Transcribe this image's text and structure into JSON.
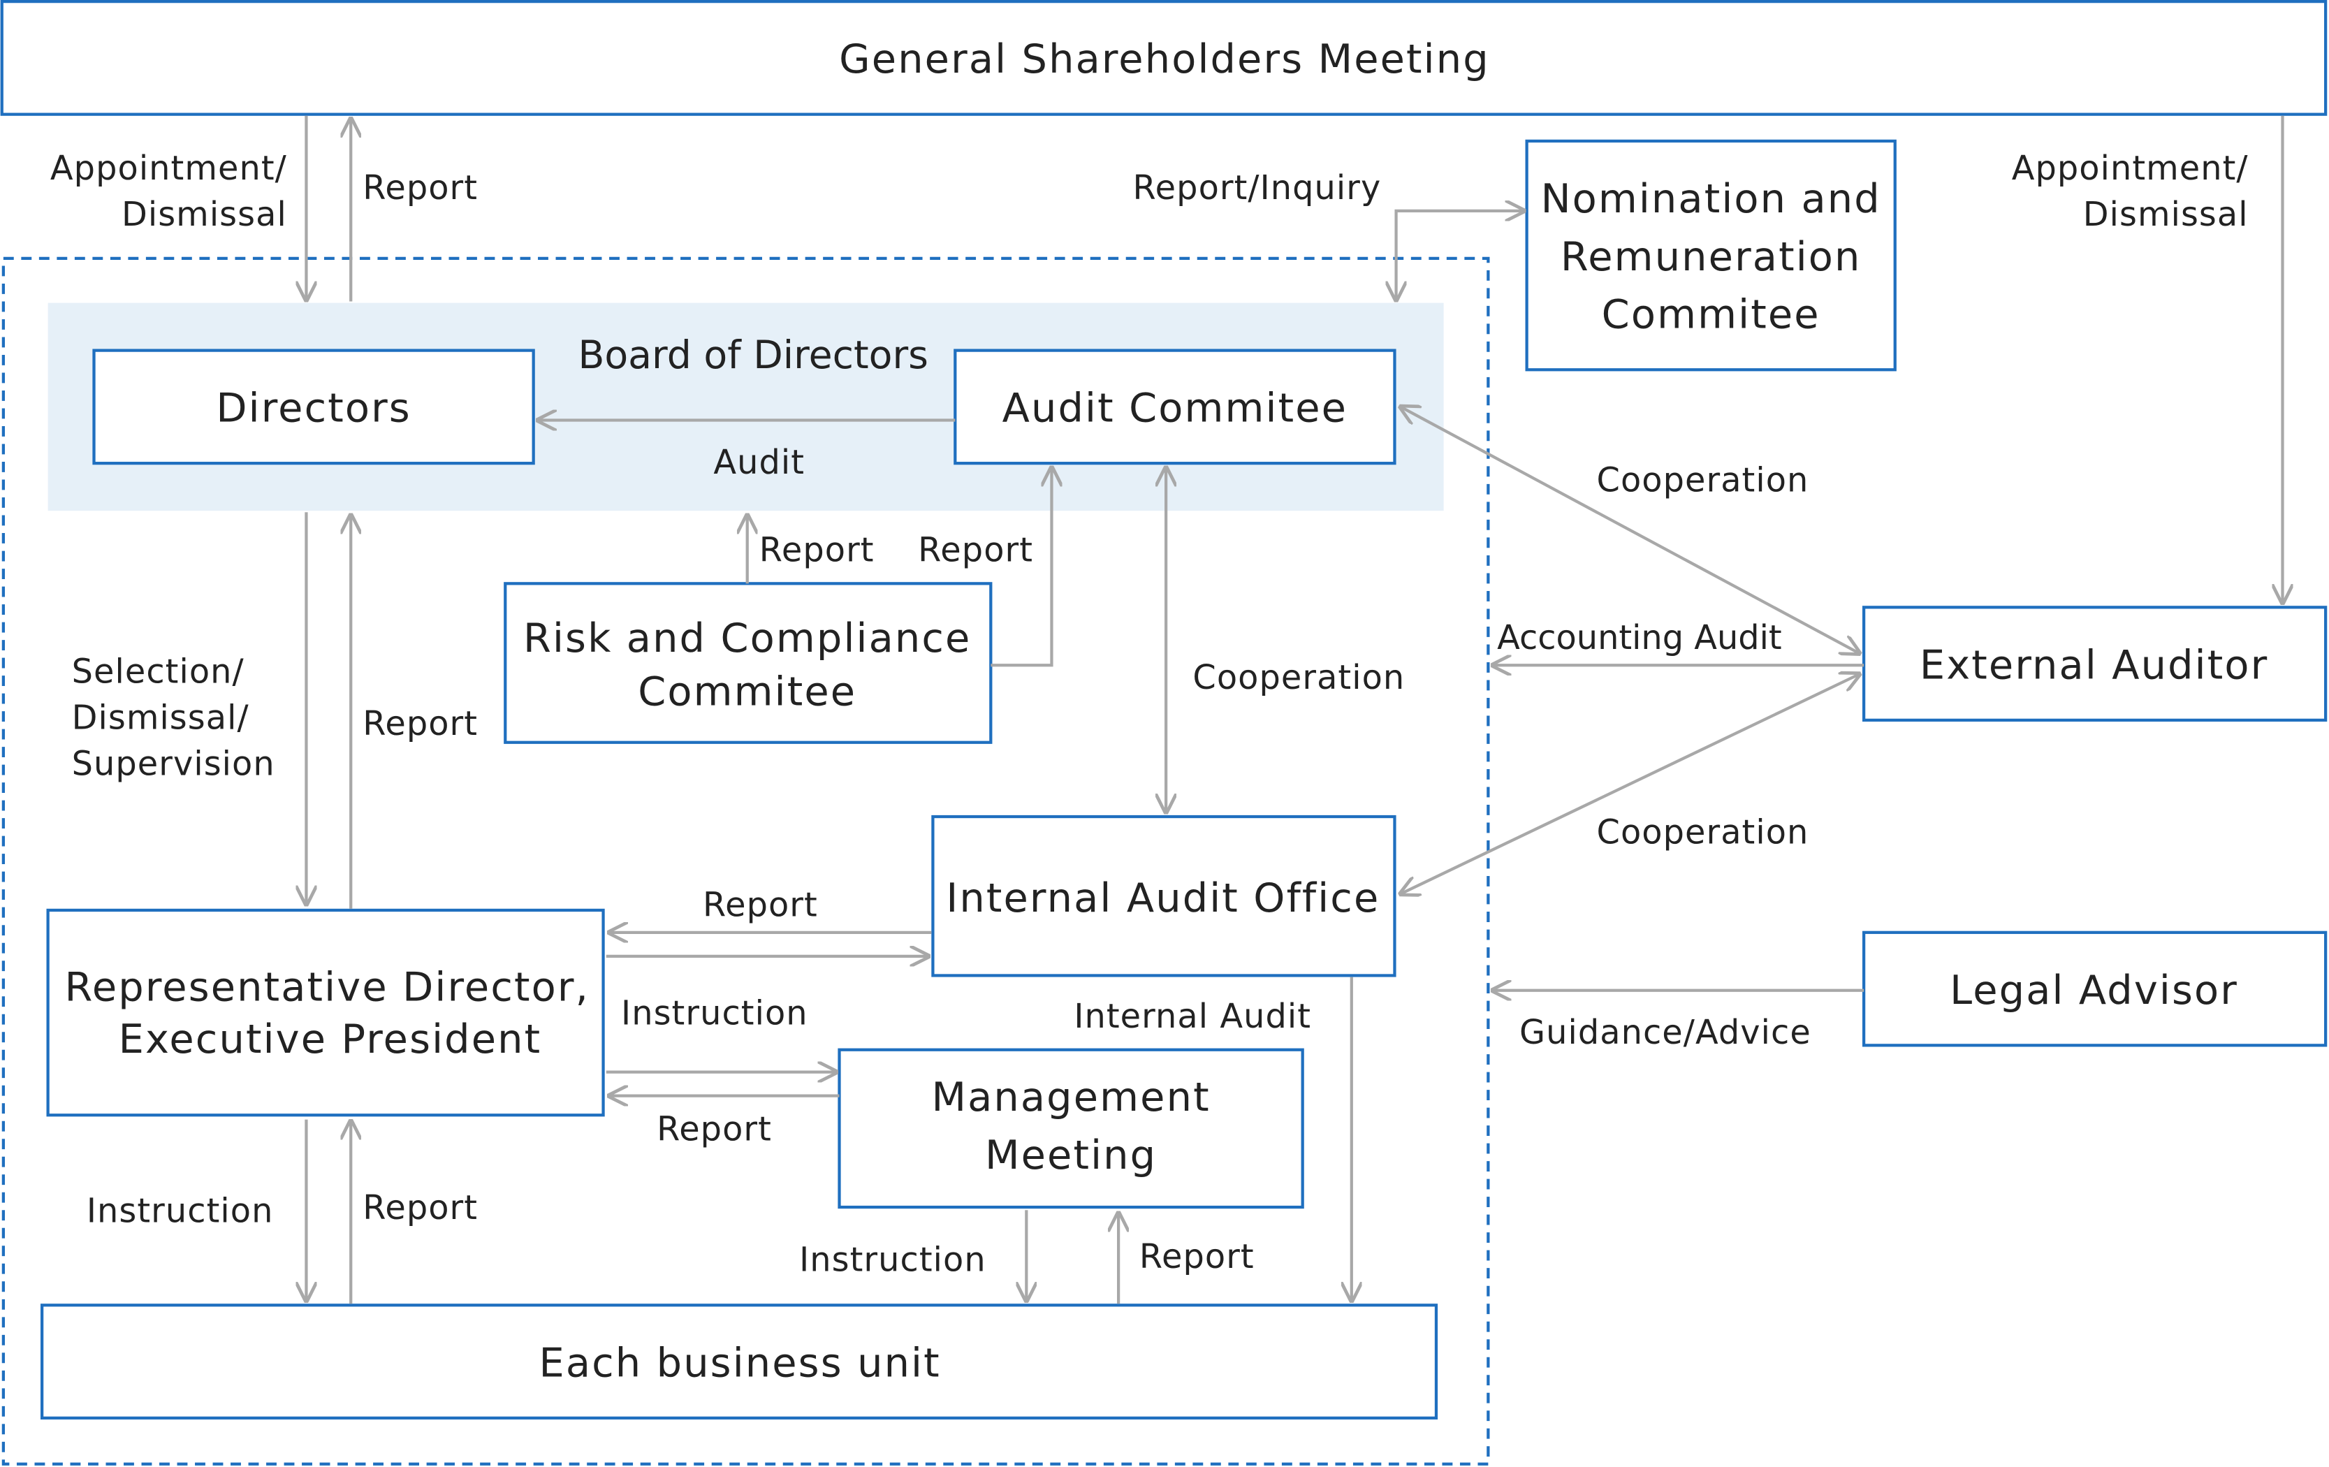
{
  "colors": {
    "border": "#1f6fbf",
    "board_bg": "#e6f0f8",
    "arrow": "#a8a8a8",
    "text": "#222222"
  },
  "boxes": {
    "gsm": "General Shareholders Meeting",
    "board": "Board of Directors",
    "directors": "Directors",
    "audit_committee": "Audit Commitee",
    "nomination": [
      "Nomination and",
      "Remuneration",
      "Commitee"
    ],
    "risk": [
      "Risk and Compliance",
      "Commitee"
    ],
    "internal_audit": "Internal Audit Office",
    "rep_director": [
      "Representative Director,",
      "Executive President"
    ],
    "management": [
      "Management",
      "Meeting"
    ],
    "business_unit": "Each business unit",
    "external_auditor": "External Auditor",
    "legal_advisor": "Legal Advisor"
  },
  "labels": {
    "appoint_left": [
      "Appointment/",
      "Dismissal"
    ],
    "report_gsm": "Report",
    "report_inquiry": "Report/Inquiry",
    "appoint_right": [
      "Appointment/",
      "Dismissal"
    ],
    "audit": "Audit",
    "risk_report1": "Report",
    "risk_report2": "Report",
    "cooperation_top": "Cooperation",
    "accounting_audit": "Accounting Audit",
    "cooperation_mid": "Cooperation",
    "cooperation_bottom": "Cooperation",
    "selection": [
      "Selection/",
      "Dismissal/",
      "Supervision"
    ],
    "report_dir": "Report",
    "report_ia": "Report",
    "instruction_mm": "Instruction",
    "internal_audit_lbl": "Internal Audit",
    "report_mm": "Report",
    "guidance": "Guidance/Advice",
    "instruction_bu": "Instruction",
    "report_bu": "Report",
    "instruction_mm_bu": "Instruction",
    "report_mm_bu": "Report"
  }
}
